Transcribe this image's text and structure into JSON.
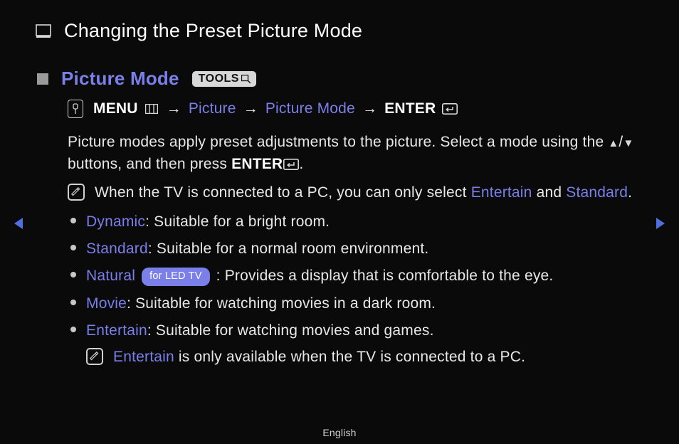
{
  "pageTitle": "Changing the Preset Picture Mode",
  "section": {
    "title": "Picture Mode",
    "toolsBadge": "TOOLS"
  },
  "path": {
    "menu": "MENU",
    "step1": "Picture",
    "step2": "Picture Mode",
    "enter": "ENTER",
    "arrow": "→"
  },
  "intro": {
    "part1": "Picture modes apply preset adjustments to the picture. Select a mode using the ",
    "part2": " buttons, and then press ",
    "enter": "ENTER",
    "slash": "/",
    "period": "."
  },
  "note1": {
    "pre": "When the TV is connected to a PC, you can only select ",
    "link1": "Entertain",
    "mid": " and ",
    "link2": "Standard",
    "post": "."
  },
  "modes": [
    {
      "name": "Dynamic",
      "desc": ": Suitable for a bright room."
    },
    {
      "name": "Standard",
      "desc": ": Suitable for a normal room environment."
    },
    {
      "name": "Natural",
      "badge": "for LED TV",
      "desc": " : Provides a display that is comfortable to the eye."
    },
    {
      "name": "Movie",
      "desc": ": Suitable for watching movies in a dark room."
    },
    {
      "name": "Entertain",
      "desc": ": Suitable for watching movies and games."
    }
  ],
  "subNote": {
    "link": "Entertain",
    "post": " is only available when the TV is connected to a PC."
  },
  "footerLang": "English"
}
